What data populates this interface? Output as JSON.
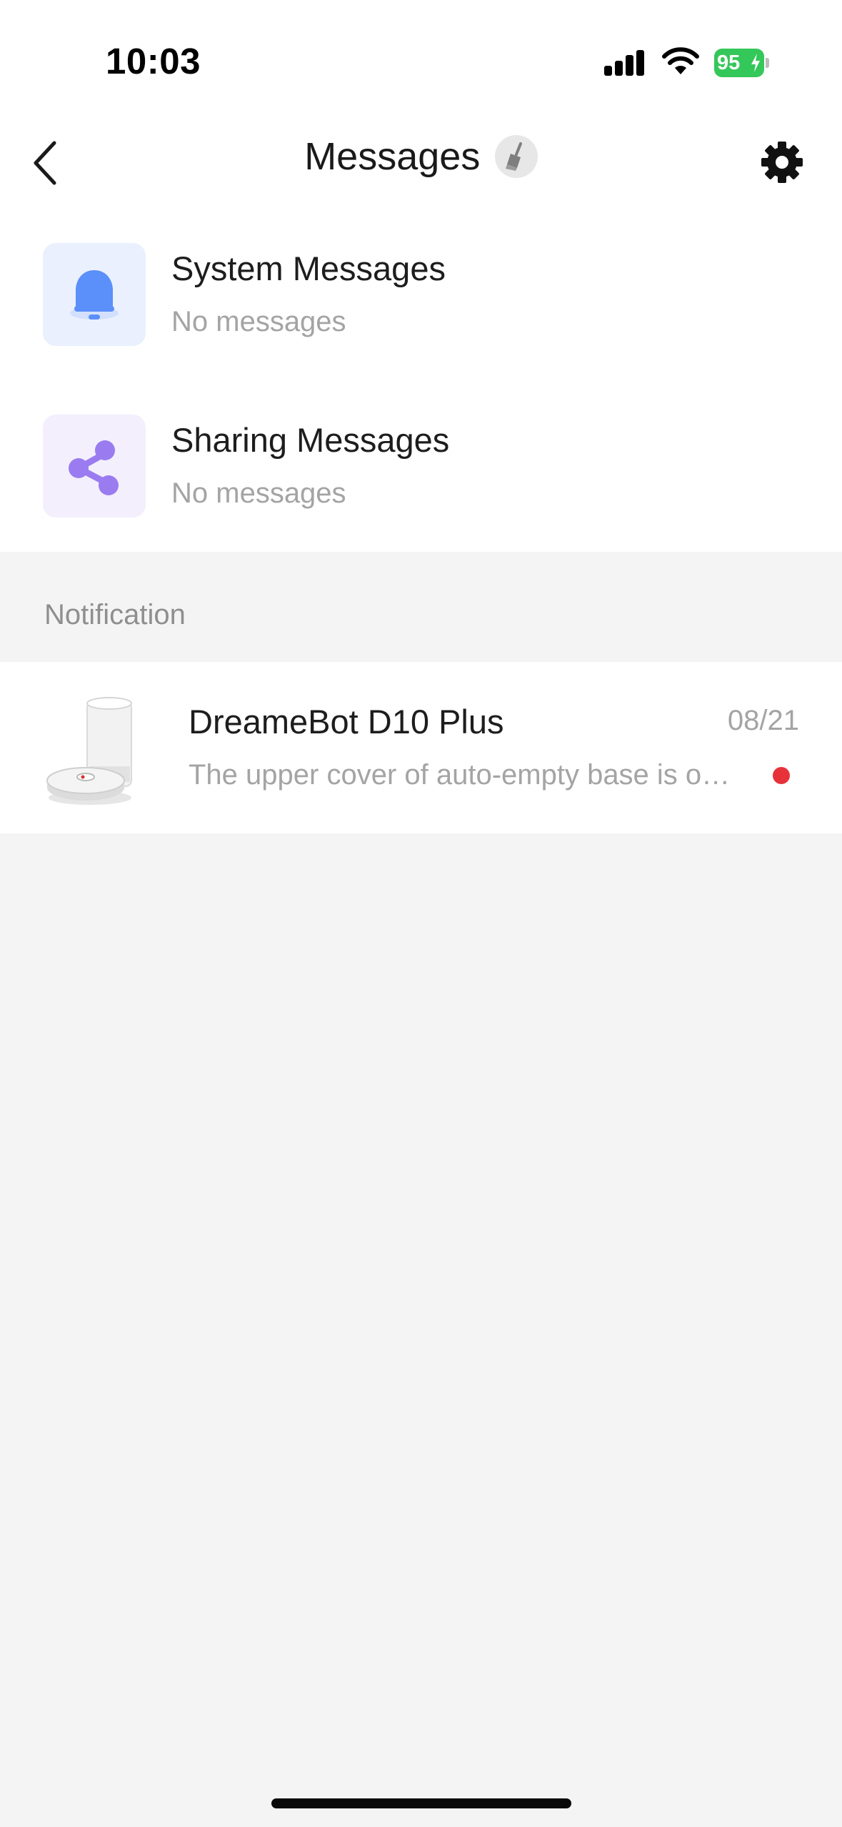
{
  "status_bar": {
    "time": "10:03",
    "battery": "95"
  },
  "header": {
    "title": "Messages",
    "back_icon": "chevron-left-icon",
    "clear_icon": "broom-icon",
    "settings_icon": "gear-icon"
  },
  "messages": [
    {
      "title": "System Messages",
      "subtitle": "No messages",
      "icon": "bell-icon",
      "icon_color": "#5b8ff9",
      "bg_color": "#eaf0fe"
    },
    {
      "title": "Sharing Messages",
      "subtitle": "No messages",
      "icon": "share-icon",
      "icon_color": "#9a7cf0",
      "bg_color": "#f3effd"
    }
  ],
  "notification": {
    "section_label": "Notification",
    "items": [
      {
        "device": "DreameBot D10 Plus",
        "date": "08/21",
        "message": "The upper cover of auto-empty base is open. Please close it.",
        "unread": true
      }
    ]
  },
  "colors": {
    "unread_dot": "#e8323a",
    "battery": "#34c759",
    "background": "#f4f4f4"
  }
}
